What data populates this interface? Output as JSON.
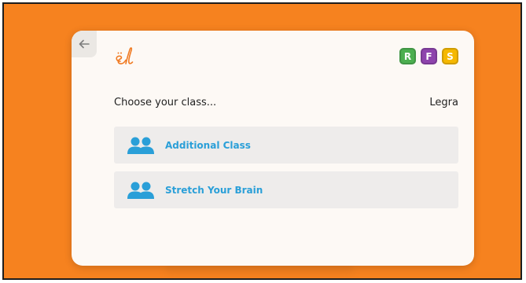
{
  "colors": {
    "background": "#f6821f",
    "card": "#fdf9f5",
    "accent": "#2a9fd8",
    "logo": "#f07a22"
  },
  "header": {
    "back_icon": "back-arrow-icon",
    "logo_icon": "el-logo-icon",
    "badges": [
      {
        "label": "R",
        "color": "#4caf50"
      },
      {
        "label": "F",
        "color": "#8e44ad"
      },
      {
        "label": "S",
        "color": "#f5b800"
      }
    ]
  },
  "main": {
    "heading": "Choose your class...",
    "username": "Legra",
    "classes": [
      {
        "label": "Additional Class",
        "icon": "group-icon"
      },
      {
        "label": "Stretch Your Brain",
        "icon": "group-icon"
      }
    ]
  }
}
